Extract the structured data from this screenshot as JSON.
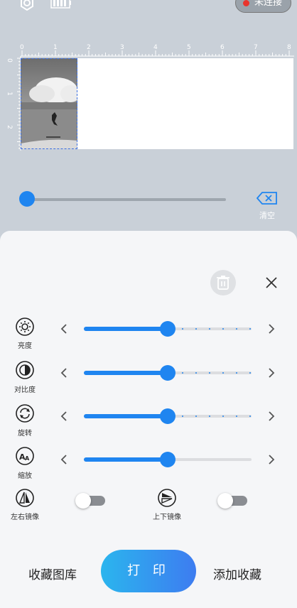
{
  "status_bar": {
    "connection_label": "未连接"
  },
  "ruler": {
    "top_ticks": [
      "0",
      "1",
      "2",
      "3",
      "4",
      "5",
      "6",
      "7",
      "8"
    ],
    "left_ticks": [
      "0",
      "1",
      "2"
    ]
  },
  "print_progress": 0,
  "clear": {
    "label": "清空"
  },
  "adjustments": [
    {
      "icon": "brightness-icon",
      "label": "亮度",
      "value": 0.5,
      "dotted": true
    },
    {
      "icon": "contrast-icon",
      "label": "对比度",
      "value": 0.5,
      "dotted": true
    },
    {
      "icon": "rotate-icon",
      "label": "旋转",
      "value": 0.5,
      "dotted": true
    },
    {
      "icon": "zoom-icon",
      "label": "缩放",
      "value": 0.5,
      "dotted": false
    }
  ],
  "mirror": {
    "horizontal_label": "左右镜像",
    "horizontal_on": false,
    "vertical_label": "上下镜像",
    "vertical_on": false
  },
  "actions": {
    "gallery": "收藏图库",
    "print": "打 印",
    "add_favorite": "添加收藏"
  },
  "colors": {
    "accent": "#1f85f0",
    "background": "#c9d0d8",
    "panel": "#f5f6f8"
  }
}
